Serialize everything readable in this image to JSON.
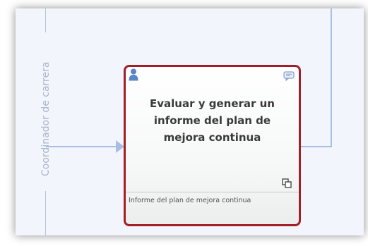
{
  "lane": {
    "label": "Coordinador de carrera"
  },
  "task": {
    "title": "Evaluar y generar un informe del plan de mejora continua",
    "output": "Informe del plan de mejora continua"
  },
  "colors": {
    "canvas": "#f2f5fb",
    "task_border": "#a31f27",
    "flow": "#a9bde3",
    "lane_text": "#a9b6cc"
  }
}
